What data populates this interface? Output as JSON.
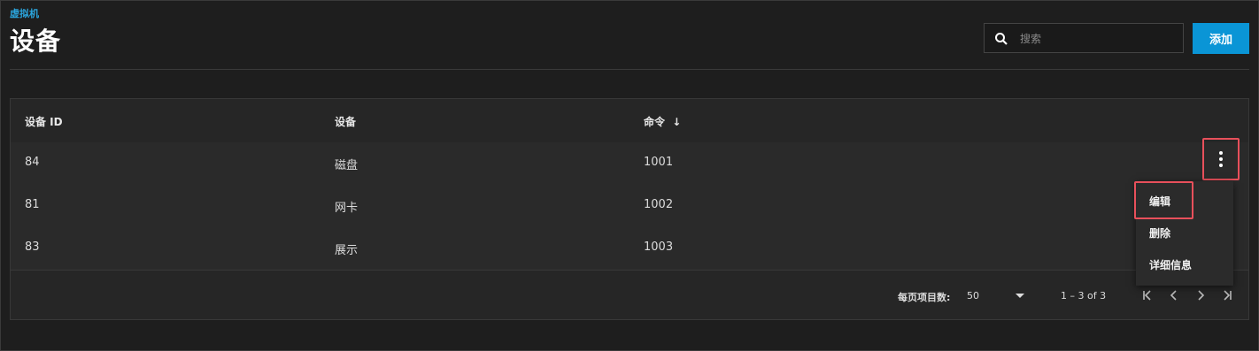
{
  "header": {
    "breadcrumb": "虚拟机",
    "title": "设备",
    "search_placeholder": "搜索",
    "add_label": "添加"
  },
  "table": {
    "columns": [
      "设备 ID",
      "设备",
      "命令"
    ],
    "sort_indicator": "↓",
    "rows": [
      {
        "id": "84",
        "device": "磁盘",
        "order": "1001"
      },
      {
        "id": "81",
        "device": "网卡",
        "order": "1002"
      },
      {
        "id": "83",
        "device": "展示",
        "order": "1003"
      }
    ]
  },
  "context_menu": {
    "items": [
      "编辑",
      "删除",
      "详细信息"
    ]
  },
  "paginator": {
    "items_per_page_label": "每页项目数:",
    "page_size": "50",
    "range": "1 – 3 of 3"
  },
  "colors": {
    "accent": "#0a95d6",
    "highlight": "#e8505b"
  }
}
